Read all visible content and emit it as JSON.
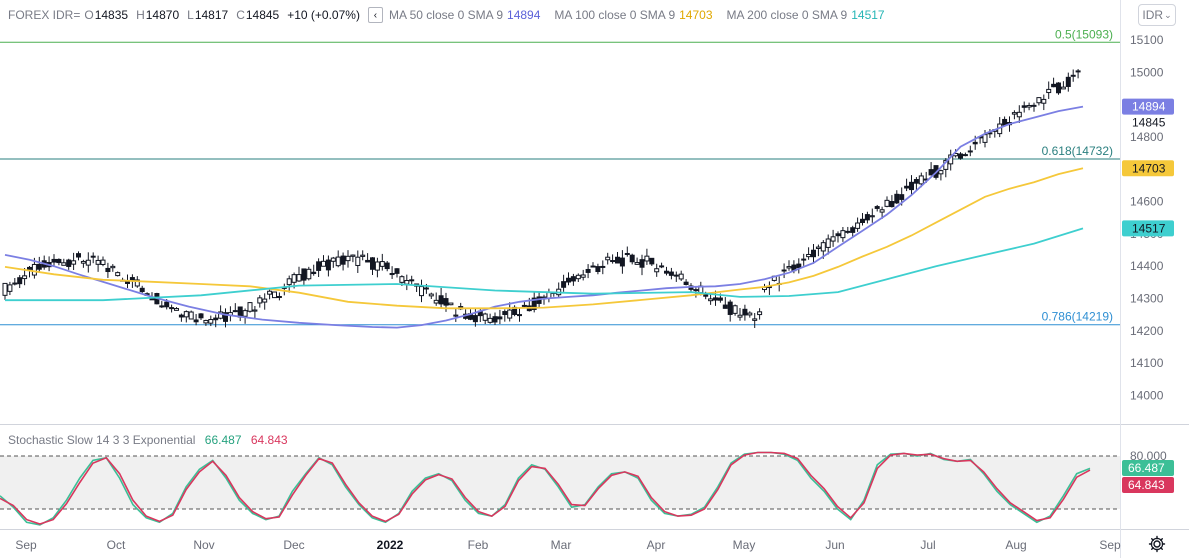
{
  "header": {
    "symbol": "FOREX IDR=",
    "o_key": "O",
    "o_val": "14835",
    "h_key": "H",
    "h_val": "14870",
    "l_key": "L",
    "l_val": "14817",
    "c_key": "C",
    "c_val": "14845",
    "change": "+10 (+0.07%)",
    "collapse_icon": "‹",
    "ma1_label": "MA 50 close 0 SMA 9",
    "ma1_value": "14894",
    "ma2_label": "MA 100 close 0 SMA 9",
    "ma2_value": "14703",
    "ma3_label": "MA 200 close 0 SMA 9",
    "ma3_value": "14517"
  },
  "currency_button": "IDR",
  "stochastic": {
    "label": "Stochastic Slow 14 3 3 Exponential",
    "k_value": "66.487",
    "d_value": "64.843",
    "upper_band": "80.000"
  },
  "fib_labels": {
    "f05": "0.5(15093)",
    "f0618": "0.618(14732)",
    "f0786": "0.786(14219)"
  },
  "colors": {
    "ma50": "#7b7fe3",
    "ma100": "#f5c83a",
    "ma200": "#3ecfcf",
    "k_line": "#3cbf97",
    "d_line": "#d9375e",
    "fib05": "#4caf50",
    "fib0618": "#2a7f7f",
    "fib0786": "#2f8fd3",
    "candle": "#131722"
  },
  "chart_data": {
    "type": "line",
    "title": "FOREX IDR=",
    "price_axis_ticks": [
      "15100",
      "15000",
      "14900",
      "14800",
      "14700",
      "14600",
      "14500",
      "14400",
      "14300",
      "14200",
      "14100",
      "14000"
    ],
    "time_axis_ticks": [
      "Sep",
      "Oct",
      "Nov",
      "Dec",
      "2022",
      "Feb",
      "Mar",
      "Apr",
      "May",
      "Jun",
      "Jul",
      "Aug",
      "Sep"
    ],
    "price_badges": [
      {
        "name": "MA 50",
        "value": 14894
      },
      {
        "name": "close",
        "value": 14845
      },
      {
        "name": "MA 100",
        "value": 14703
      },
      {
        "name": "MA 200",
        "value": 14517
      }
    ],
    "fib_levels": [
      {
        "ratio": "0.5",
        "price": 15093
      },
      {
        "ratio": "0.618",
        "price": 14732
      },
      {
        "ratio": "0.786",
        "price": 14219
      }
    ],
    "ohlc_last": {
      "open": 14835,
      "high": 14870,
      "low": 14817,
      "close": 14845
    },
    "series": [
      {
        "name": "MA 50 close 0 SMA 9",
        "points": [
          [
            0,
            14435
          ],
          [
            10,
            14420
          ],
          [
            20,
            14400
          ],
          [
            30,
            14375
          ],
          [
            45,
            14340
          ],
          [
            60,
            14305
          ],
          [
            75,
            14275
          ],
          [
            90,
            14250
          ],
          [
            105,
            14235
          ],
          [
            120,
            14225
          ],
          [
            135,
            14218
          ],
          [
            150,
            14212
          ],
          [
            160,
            14210
          ],
          [
            170,
            14218
          ],
          [
            180,
            14232
          ],
          [
            190,
            14252
          ],
          [
            200,
            14275
          ],
          [
            210,
            14290
          ],
          [
            220,
            14300
          ],
          [
            230,
            14305
          ],
          [
            240,
            14310
          ],
          [
            250,
            14318
          ],
          [
            260,
            14325
          ],
          [
            270,
            14332
          ],
          [
            280,
            14336
          ],
          [
            290,
            14338
          ],
          [
            300,
            14345
          ],
          [
            310,
            14360
          ],
          [
            320,
            14380
          ],
          [
            330,
            14410
          ],
          [
            340,
            14460
          ],
          [
            350,
            14510
          ],
          [
            360,
            14560
          ],
          [
            370,
            14620
          ],
          [
            380,
            14690
          ],
          [
            390,
            14770
          ],
          [
            400,
            14810
          ],
          [
            410,
            14840
          ],
          [
            420,
            14860
          ],
          [
            430,
            14880
          ],
          [
            440,
            14894
          ]
        ]
      },
      {
        "name": "MA 100 close 0 SMA 9",
        "points": [
          [
            0,
            14398
          ],
          [
            20,
            14375
          ],
          [
            40,
            14358
          ],
          [
            60,
            14352
          ],
          [
            80,
            14345
          ],
          [
            100,
            14338
          ],
          [
            120,
            14318
          ],
          [
            140,
            14290
          ],
          [
            160,
            14278
          ],
          [
            180,
            14270
          ],
          [
            200,
            14270
          ],
          [
            220,
            14272
          ],
          [
            240,
            14282
          ],
          [
            260,
            14296
          ],
          [
            280,
            14310
          ],
          [
            300,
            14328
          ],
          [
            310,
            14336
          ],
          [
            320,
            14350
          ],
          [
            330,
            14370
          ],
          [
            340,
            14398
          ],
          [
            350,
            14430
          ],
          [
            360,
            14460
          ],
          [
            370,
            14495
          ],
          [
            380,
            14535
          ],
          [
            390,
            14575
          ],
          [
            400,
            14615
          ],
          [
            410,
            14640
          ],
          [
            420,
            14660
          ],
          [
            430,
            14685
          ],
          [
            440,
            14703
          ]
        ]
      },
      {
        "name": "MA 200 close 0 SMA 9",
        "points": [
          [
            0,
            14295
          ],
          [
            40,
            14295
          ],
          [
            80,
            14310
          ],
          [
            120,
            14340
          ],
          [
            160,
            14345
          ],
          [
            200,
            14325
          ],
          [
            240,
            14315
          ],
          [
            280,
            14320
          ],
          [
            300,
            14305
          ],
          [
            320,
            14308
          ],
          [
            340,
            14320
          ],
          [
            360,
            14360
          ],
          [
            380,
            14400
          ],
          [
            400,
            14435
          ],
          [
            420,
            14470
          ],
          [
            440,
            14517
          ]
        ]
      }
    ],
    "stochastic_series": [
      {
        "name": "%K",
        "values": [
          35,
          22,
          5,
          2,
          10,
          30,
          55,
          75,
          78,
          55,
          25,
          10,
          5,
          15,
          45,
          65,
          75,
          55,
          30,
          15,
          8,
          12,
          40,
          60,
          78,
          70,
          45,
          25,
          10,
          5,
          15,
          40,
          55,
          60,
          52,
          30,
          15,
          12,
          25,
          55,
          70,
          65,
          45,
          22,
          25,
          45,
          60,
          62,
          55,
          30,
          15,
          12,
          14,
          22,
          45,
          72,
          82,
          84,
          84,
          82,
          75,
          55,
          40,
          20,
          8,
          30,
          70,
          82,
          83,
          80,
          83,
          76,
          74,
          76,
          60,
          40,
          25,
          15,
          5,
          12,
          35,
          60,
          66
        ]
      },
      {
        "name": "%D",
        "values": [
          32,
          24,
          8,
          3,
          8,
          26,
          50,
          72,
          78,
          60,
          30,
          12,
          6,
          13,
          42,
          62,
          74,
          58,
          33,
          17,
          9,
          11,
          36,
          58,
          77,
          72,
          48,
          27,
          12,
          6,
          14,
          37,
          53,
          59,
          54,
          33,
          17,
          12,
          23,
          52,
          68,
          66,
          48,
          25,
          24,
          43,
          58,
          62,
          57,
          33,
          17,
          12,
          13,
          20,
          42,
          70,
          81,
          84,
          84,
          83,
          77,
          58,
          43,
          23,
          10,
          27,
          66,
          81,
          83,
          81,
          82,
          77,
          74,
          75,
          62,
          43,
          27,
          17,
          7,
          10,
          31,
          56,
          64
        ]
      }
    ]
  }
}
